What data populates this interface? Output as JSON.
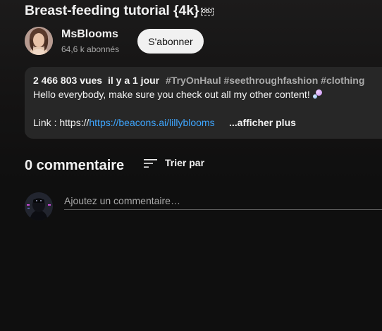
{
  "video": {
    "title": "Breast-feeding tutorial {4k}",
    "title_glyph": "OBJ"
  },
  "channel": {
    "name": "MsBlooms",
    "subscribers": "64,6 k abonnés",
    "subscribe_label": "S'abonner"
  },
  "description": {
    "views": "2 466 803 vues",
    "age": "il y a 1 jour",
    "tags": "#TryOnHaul #seethroughfashion #clothing",
    "line1": "Hello everybody, make sure you check out all my other content!",
    "link_prefix": "Link : https://",
    "link_text": "https://beacons.ai/lillyblooms",
    "show_more": "...afficher plus"
  },
  "comments": {
    "count_label": "0 commentaire",
    "sort_label": "Trier par",
    "input_placeholder": "Ajoutez un commentaire…"
  },
  "icons": {
    "sort": "sort-icon",
    "channel_avatar": "channel-avatar",
    "user_avatar": "user-avatar"
  },
  "colors": {
    "background": "#0f0f0f",
    "link": "#3ea6ff",
    "subscribe_bg": "#f1f1f1",
    "description_bg": "#272727"
  }
}
